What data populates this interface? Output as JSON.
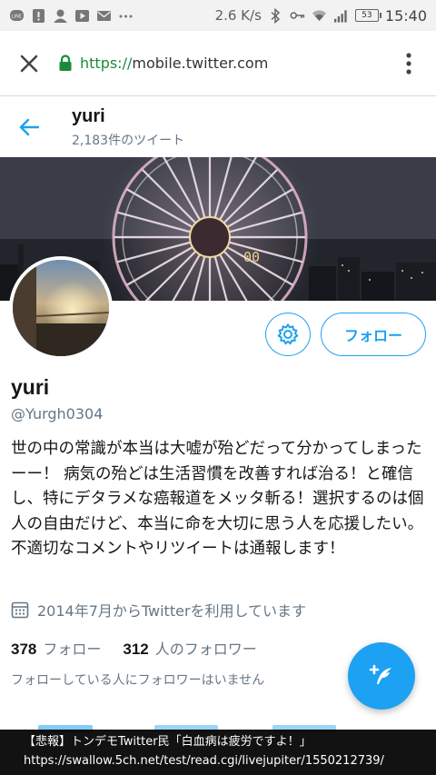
{
  "status_bar": {
    "icons": [
      "line-icon",
      "alert-icon",
      "person-icon",
      "play-icon",
      "mail-icon",
      "more-icon"
    ],
    "net_speed": "2.6 K/s",
    "battery": "53",
    "time": "15:40"
  },
  "browser": {
    "url_scheme": "https://",
    "url_host": "mobile.twitter.com"
  },
  "profile_header": {
    "name": "yuri",
    "tweet_count": "2,183件のツイート"
  },
  "profile": {
    "name": "yuri",
    "handle": "@Yurgh0304",
    "bio": "世の中の常識が本当は大嘘が殆どだって分かってしまったーー！ 病気の殆どは生活習慣を改善すれば治る！と確信し、特にデタラメな癌報道をメッタ斬る！選択するのは個人の自由だけど、本当に命を大切に思う人を応援したい。 不適切なコメントやリツイートは通報します！",
    "joined": "2014年7月からTwitterを利用しています",
    "following_count": "378",
    "following_label": "フォロー",
    "followers_count": "312",
    "followers_label": "人のフォロワー",
    "followers_note": "フォローしている人にフォロワーはいません",
    "follow_button": "フォロー"
  },
  "caption": {
    "line1": "【悲報】トンデモTwitter民「白血病は疲労ですよ！」",
    "line2": "https://swallow.5ch.net/test/read.cgi/livejupiter/1550212739/"
  },
  "colors": {
    "accent": "#1da1f2",
    "secure": "#1b8a3b",
    "muted": "#657786"
  }
}
